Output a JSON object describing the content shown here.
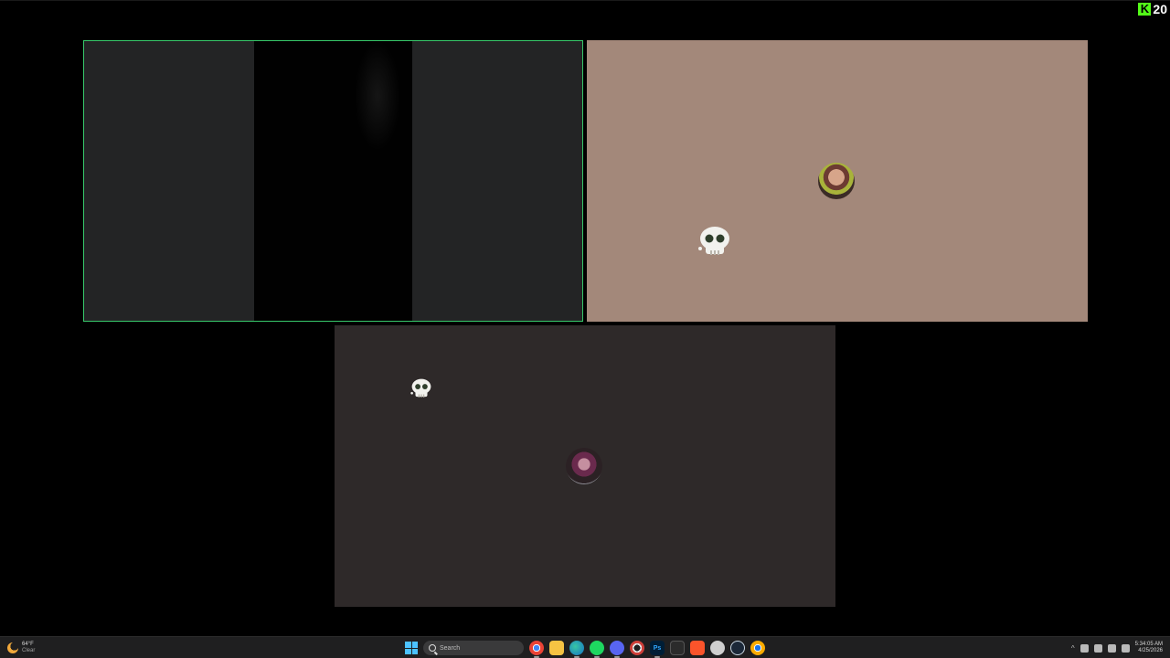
{
  "overlay": {
    "brand_letter": "K",
    "score": "20",
    "brand_color": "#53fc18"
  },
  "call": {
    "tiles": [
      {
        "id": "screen-share",
        "active_speaker": true,
        "border_color": "#37c86a",
        "bg": "#232425"
      },
      {
        "id": "participant-2",
        "bg": "#a3887a",
        "avatar": "avatar",
        "sticker": "skull-icon"
      },
      {
        "id": "participant-3",
        "bg": "#2e2929",
        "avatar": "avatar",
        "sticker": "skull-icon"
      }
    ]
  },
  "taskbar": {
    "weather": {
      "temp": "64°F",
      "condition": "Clear",
      "icon": "moon-icon"
    },
    "search_placeholder": "Search",
    "apps": [
      {
        "name": "windows-start-icon"
      },
      {
        "name": "chrome-icon",
        "active": true
      },
      {
        "name": "file-explorer-icon"
      },
      {
        "name": "edge-icon"
      },
      {
        "name": "spotify-icon"
      },
      {
        "name": "discord-icon"
      },
      {
        "name": "app-icon"
      },
      {
        "name": "photoshop-icon",
        "label": "Ps"
      },
      {
        "name": "terminal-icon"
      },
      {
        "name": "brave-icon"
      },
      {
        "name": "circle-app-icon"
      },
      {
        "name": "steam-icon"
      },
      {
        "name": "chrome-canary-icon"
      }
    ],
    "clock": {
      "time": "5:34:05 AM",
      "date": "4/25/2026"
    }
  }
}
